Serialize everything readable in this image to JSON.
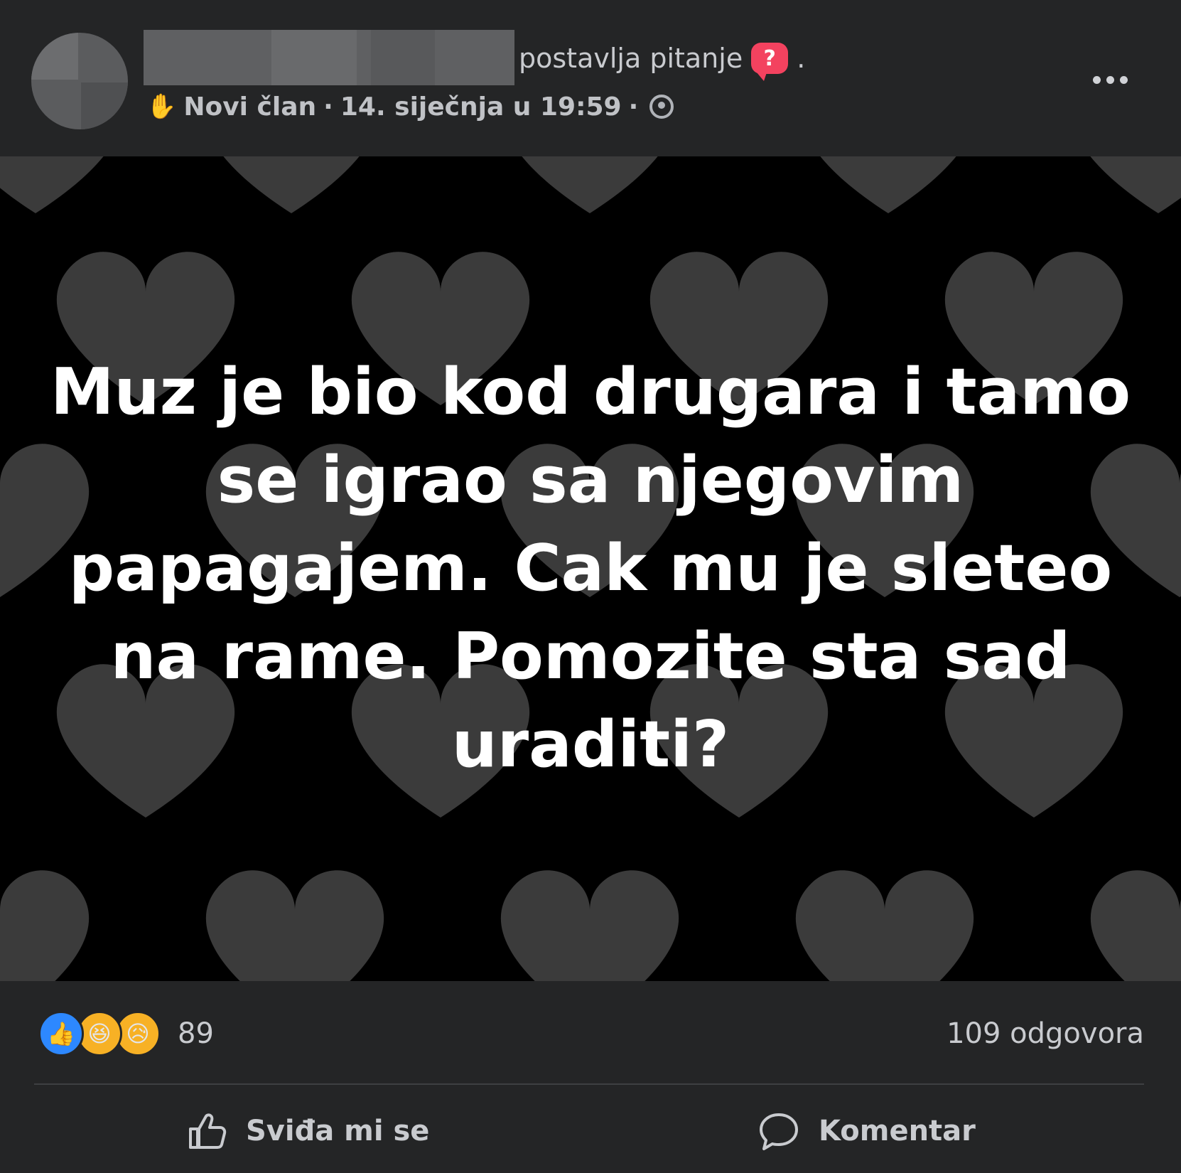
{
  "header": {
    "author_name": "",
    "action_text": "postavlja pitanje",
    "question_badge": "?",
    "trailing_dot": ".",
    "member_label": "Novi član",
    "separator": "·",
    "date": "14. siječnja u 19:59",
    "wave_icon": "waving-hand-icon",
    "audience_icon": "group-icon",
    "more_icon": "more-options-icon"
  },
  "post": {
    "text": "Muz je bio kod drugara i tamo se igrao sa njegovim papagajem. Cak mu je sleteo na rame. Pomozite sta sad uraditi?",
    "background": "black-with-grey-hearts"
  },
  "footer": {
    "reactions": [
      "like",
      "haha",
      "sad"
    ],
    "reaction_count": "89",
    "answers_count": "109 odgovora",
    "like_label": "Sviđa mi se",
    "comment_label": "Komentar"
  },
  "colors": {
    "card_bg": "#242526",
    "question_badge": "#f3425f",
    "like_blue": "#2d88ff",
    "heart_grey": "#3a3a3a"
  }
}
